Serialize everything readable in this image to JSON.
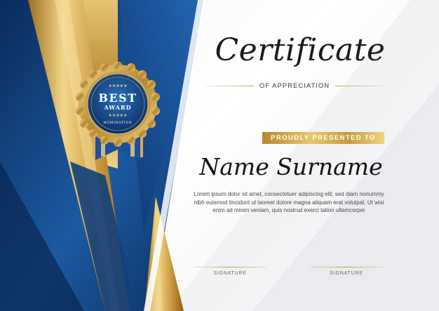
{
  "certificate": {
    "title": "Certificate",
    "subtitle": "OF APPRECIATION",
    "presented_label": "PROUDLY PRESENTED TO",
    "recipient_name": "Name Surname",
    "body_text": "Lorem ipsum dolor sit amet, consectetuer adipiscing elit, sed diam nonummy nibh euismod tincidunt ut laoreet dolore magna aliquam erat volutpat. Ut wisi enim ad minim veniam, quis nostrud exerci tation ullamcorper",
    "signatures": [
      {
        "label": "SIGNATURE"
      },
      {
        "label": "SIGNATURE"
      }
    ]
  },
  "badge": {
    "line1": "BEST",
    "line2": "AWARD",
    "line3": "NOMINATION",
    "stars": "★★★★★"
  },
  "colors": {
    "navy": "#0c2f63",
    "blue": "#1e5ea6",
    "gold": "#d4ad55",
    "gold_dark": "#a87a28"
  }
}
